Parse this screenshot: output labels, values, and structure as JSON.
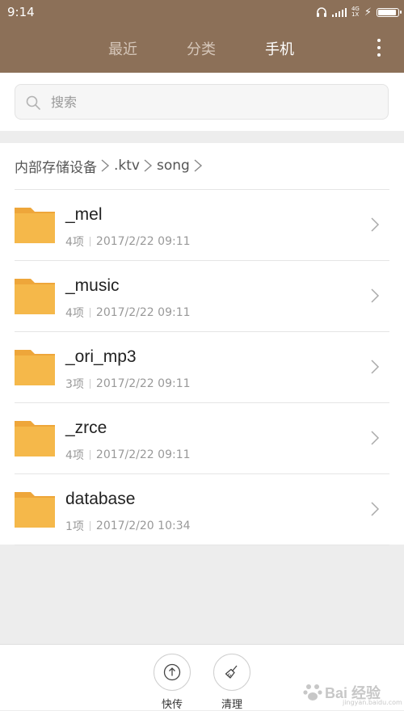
{
  "status_bar": {
    "time": "9:14",
    "network_top": "4G",
    "network_bottom": "1X",
    "battery_level": 0.95
  },
  "tabs": [
    {
      "label": "最近",
      "active": false
    },
    {
      "label": "分类",
      "active": false
    },
    {
      "label": "手机",
      "active": true
    }
  ],
  "search": {
    "placeholder": "搜索",
    "value": ""
  },
  "breadcrumb": [
    "内部存储设备",
    ".ktv",
    "song"
  ],
  "files": [
    {
      "name": "_mel",
      "count": "4项",
      "date": "2017/2/22 09:11"
    },
    {
      "name": "_music",
      "count": "4项",
      "date": "2017/2/22 09:11"
    },
    {
      "name": "_ori_mp3",
      "count": "3项",
      "date": "2017/2/22 09:11"
    },
    {
      "name": "_zrce",
      "count": "4项",
      "date": "2017/2/22 09:11"
    },
    {
      "name": "database",
      "count": "1项",
      "date": "2017/2/20 10:34"
    }
  ],
  "bottom_actions": [
    {
      "label": "快传",
      "icon": "upload-icon"
    },
    {
      "label": "清理",
      "icon": "broom-icon"
    }
  ],
  "watermark": {
    "brand": "Bai 经验",
    "url": "jingyan.baidu.com"
  },
  "colors": {
    "header": "#8c7058",
    "folder": "#f5b84a",
    "folder_tab": "#eea63a"
  }
}
